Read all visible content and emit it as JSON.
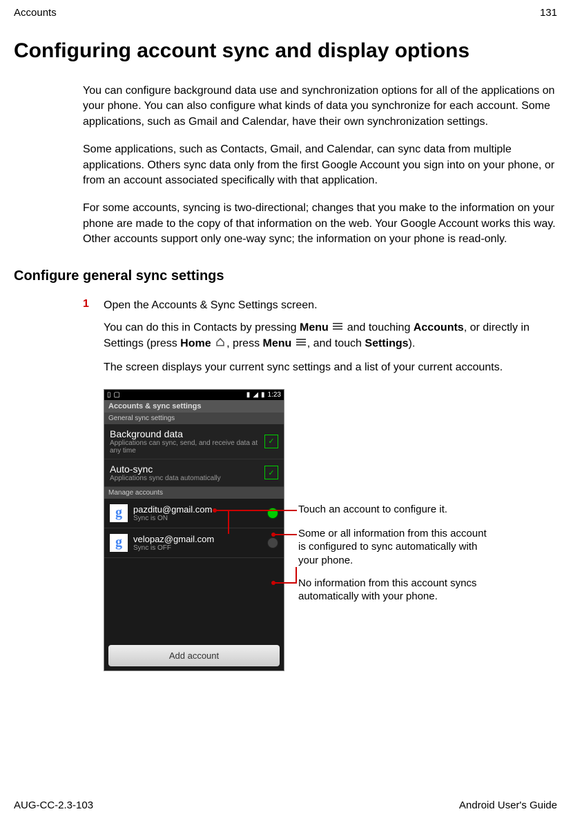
{
  "header": {
    "left": "Accounts",
    "right": "131"
  },
  "title": "Configuring account sync and display options",
  "para1": "You can configure background data use and synchronization options for all of the applications on your phone. You can also configure what kinds of data you synchronize for each account. Some applications, such as Gmail and Calendar, have their own synchronization settings.",
  "para2": "Some applications, such as Contacts, Gmail, and Calendar, can sync data from multiple applications. Others sync data only from the first Google Account you sign into on your phone, or from an account associated specifically with that application.",
  "para3": "For some accounts, syncing is two-directional; changes that you make to the information on your phone are made to the copy of that information on the web. Your Google Account works this way. Other accounts support only one-way sync; the information on your phone is read-only.",
  "sectionHeading": "Configure general sync settings",
  "step1": {
    "num": "1",
    "text": "Open the Accounts & Sync Settings screen.",
    "sub1a": "You can do this in Contacts by pressing ",
    "sub1b": " and touching ",
    "sub1c": ", or directly in Settings (press ",
    "sub1d": ", press ",
    "sub1e": ", and touch ",
    "sub1f": ").",
    "boldMenu": "Menu",
    "boldAccounts": "Accounts",
    "boldHome": "Home",
    "boldSettings": "Settings",
    "sub2": "The screen displays your current sync settings and a list of your current accounts."
  },
  "phone": {
    "time": "1:23",
    "topHeader": "Accounts & sync settings",
    "subHeader": "General sync settings",
    "bgData": {
      "title": "Background data",
      "sub": "Applications can sync, send, and receive data at any time"
    },
    "autoSync": {
      "title": "Auto-sync",
      "sub": "Applications sync data automatically"
    },
    "manageHeader": "Manage accounts",
    "accounts": [
      {
        "email": "pazditu@gmail.com",
        "status": "Sync is ON",
        "on": true
      },
      {
        "email": "velopaz@gmail.com",
        "status": "Sync is OFF",
        "on": false
      }
    ],
    "addButton": "Add account"
  },
  "callouts": {
    "c1": "Touch an account to configure it.",
    "c2": "Some or all information from this account is configured to sync automatically with your phone.",
    "c3": "No information from this account syncs automatically with your phone."
  },
  "footer": {
    "left": "AUG-CC-2.3-103",
    "right": "Android User's Guide"
  }
}
